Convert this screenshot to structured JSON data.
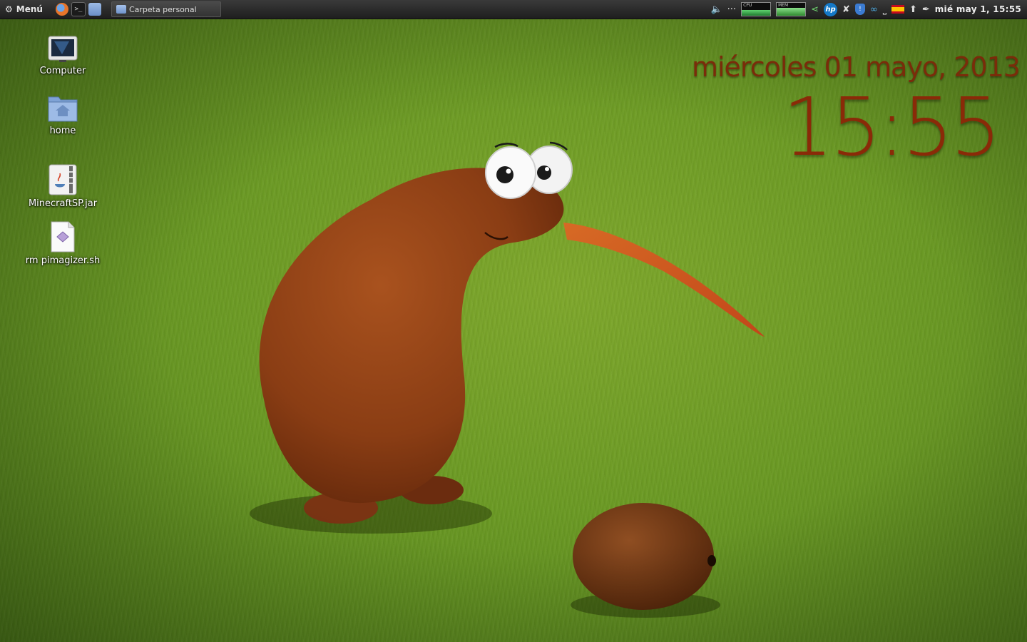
{
  "panel": {
    "menu_label": "Menú",
    "taskbar": [
      {
        "label": "Carpeta personal"
      }
    ],
    "graphs": [
      {
        "label": "CPU",
        "color": "#2fa34a"
      },
      {
        "label": "MEM",
        "color": "#3f9c3f"
      }
    ],
    "hp_label": "hp",
    "clock": "mié may  1, 15:55"
  },
  "desktop_icons": [
    {
      "label": "Computer"
    },
    {
      "label": "home"
    },
    {
      "label": "MinecraftSP.jar"
    },
    {
      "label": "rm pimagizer.sh"
    }
  ],
  "widget": {
    "date": "miércoles 01 mayo, 2013",
    "time": "15:55"
  },
  "colors": {
    "widget_text": "#7a2c0a",
    "grass": "#6b9a24",
    "kiwi_body": "#8a3d14"
  }
}
